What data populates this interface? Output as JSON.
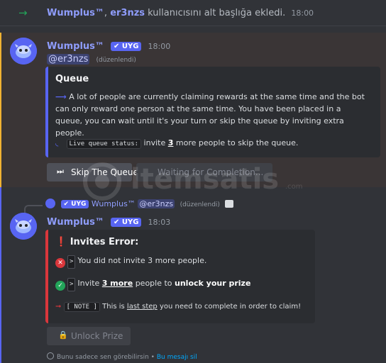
{
  "system_message": {
    "user": "Wumplus™",
    "separator": ",",
    "target": "er3nzs",
    "text": "kullanıcısını alt başlığa ekledi.",
    "time": "18:00"
  },
  "message1": {
    "author": "Wumplus™",
    "badge": "✔ UYG",
    "time": "18:00",
    "mention": "@er3nzs",
    "edited": "(düzenlendi)",
    "embed": {
      "title": "Queue",
      "description": "A lot of people are currently claiming rewards at the same time and the bot can only reward one person at the same time. You have been placed in a queue, you can wait until it's your turn or skip the queue by inviting extra people.",
      "status_label": "Live queue status:",
      "status_pre": "invite",
      "status_count": "3",
      "status_post": "more people to skip the queue."
    },
    "buttons": {
      "skip": "Skip The Queue",
      "waiting": "Waiting for Completion..."
    }
  },
  "message2": {
    "reply": {
      "badge": "✔ UYG",
      "author": "Wumplus™",
      "mention": "@er3nzs",
      "edited": "(düzenlendi)"
    },
    "author": "Wumplus™",
    "badge": "✔ UYG",
    "time": "18:03",
    "embed": {
      "title": "Invites Error:",
      "line1": "You did not invite 3 more people.",
      "line2_pre": "Invite",
      "line2_bold": "3 more",
      "line2_mid": "people to",
      "line2_bold2": "unlock your prize",
      "note_label": "[ NOTE ]",
      "line3_pre": "This is",
      "line3_link": "last step",
      "line3_post": "you need to complete in order to claim!"
    },
    "button": "Unlock Prize",
    "footer": {
      "text": "Bunu sadece sen görebilirsin •",
      "link": "Bu mesajı sil"
    }
  },
  "watermark": {
    "brand": "itemsatis",
    "suffix": ".com"
  },
  "colors": {
    "accent": "#5865f2",
    "highlight": "#f0b232",
    "error": "#da373c",
    "success": "#23a55a"
  }
}
